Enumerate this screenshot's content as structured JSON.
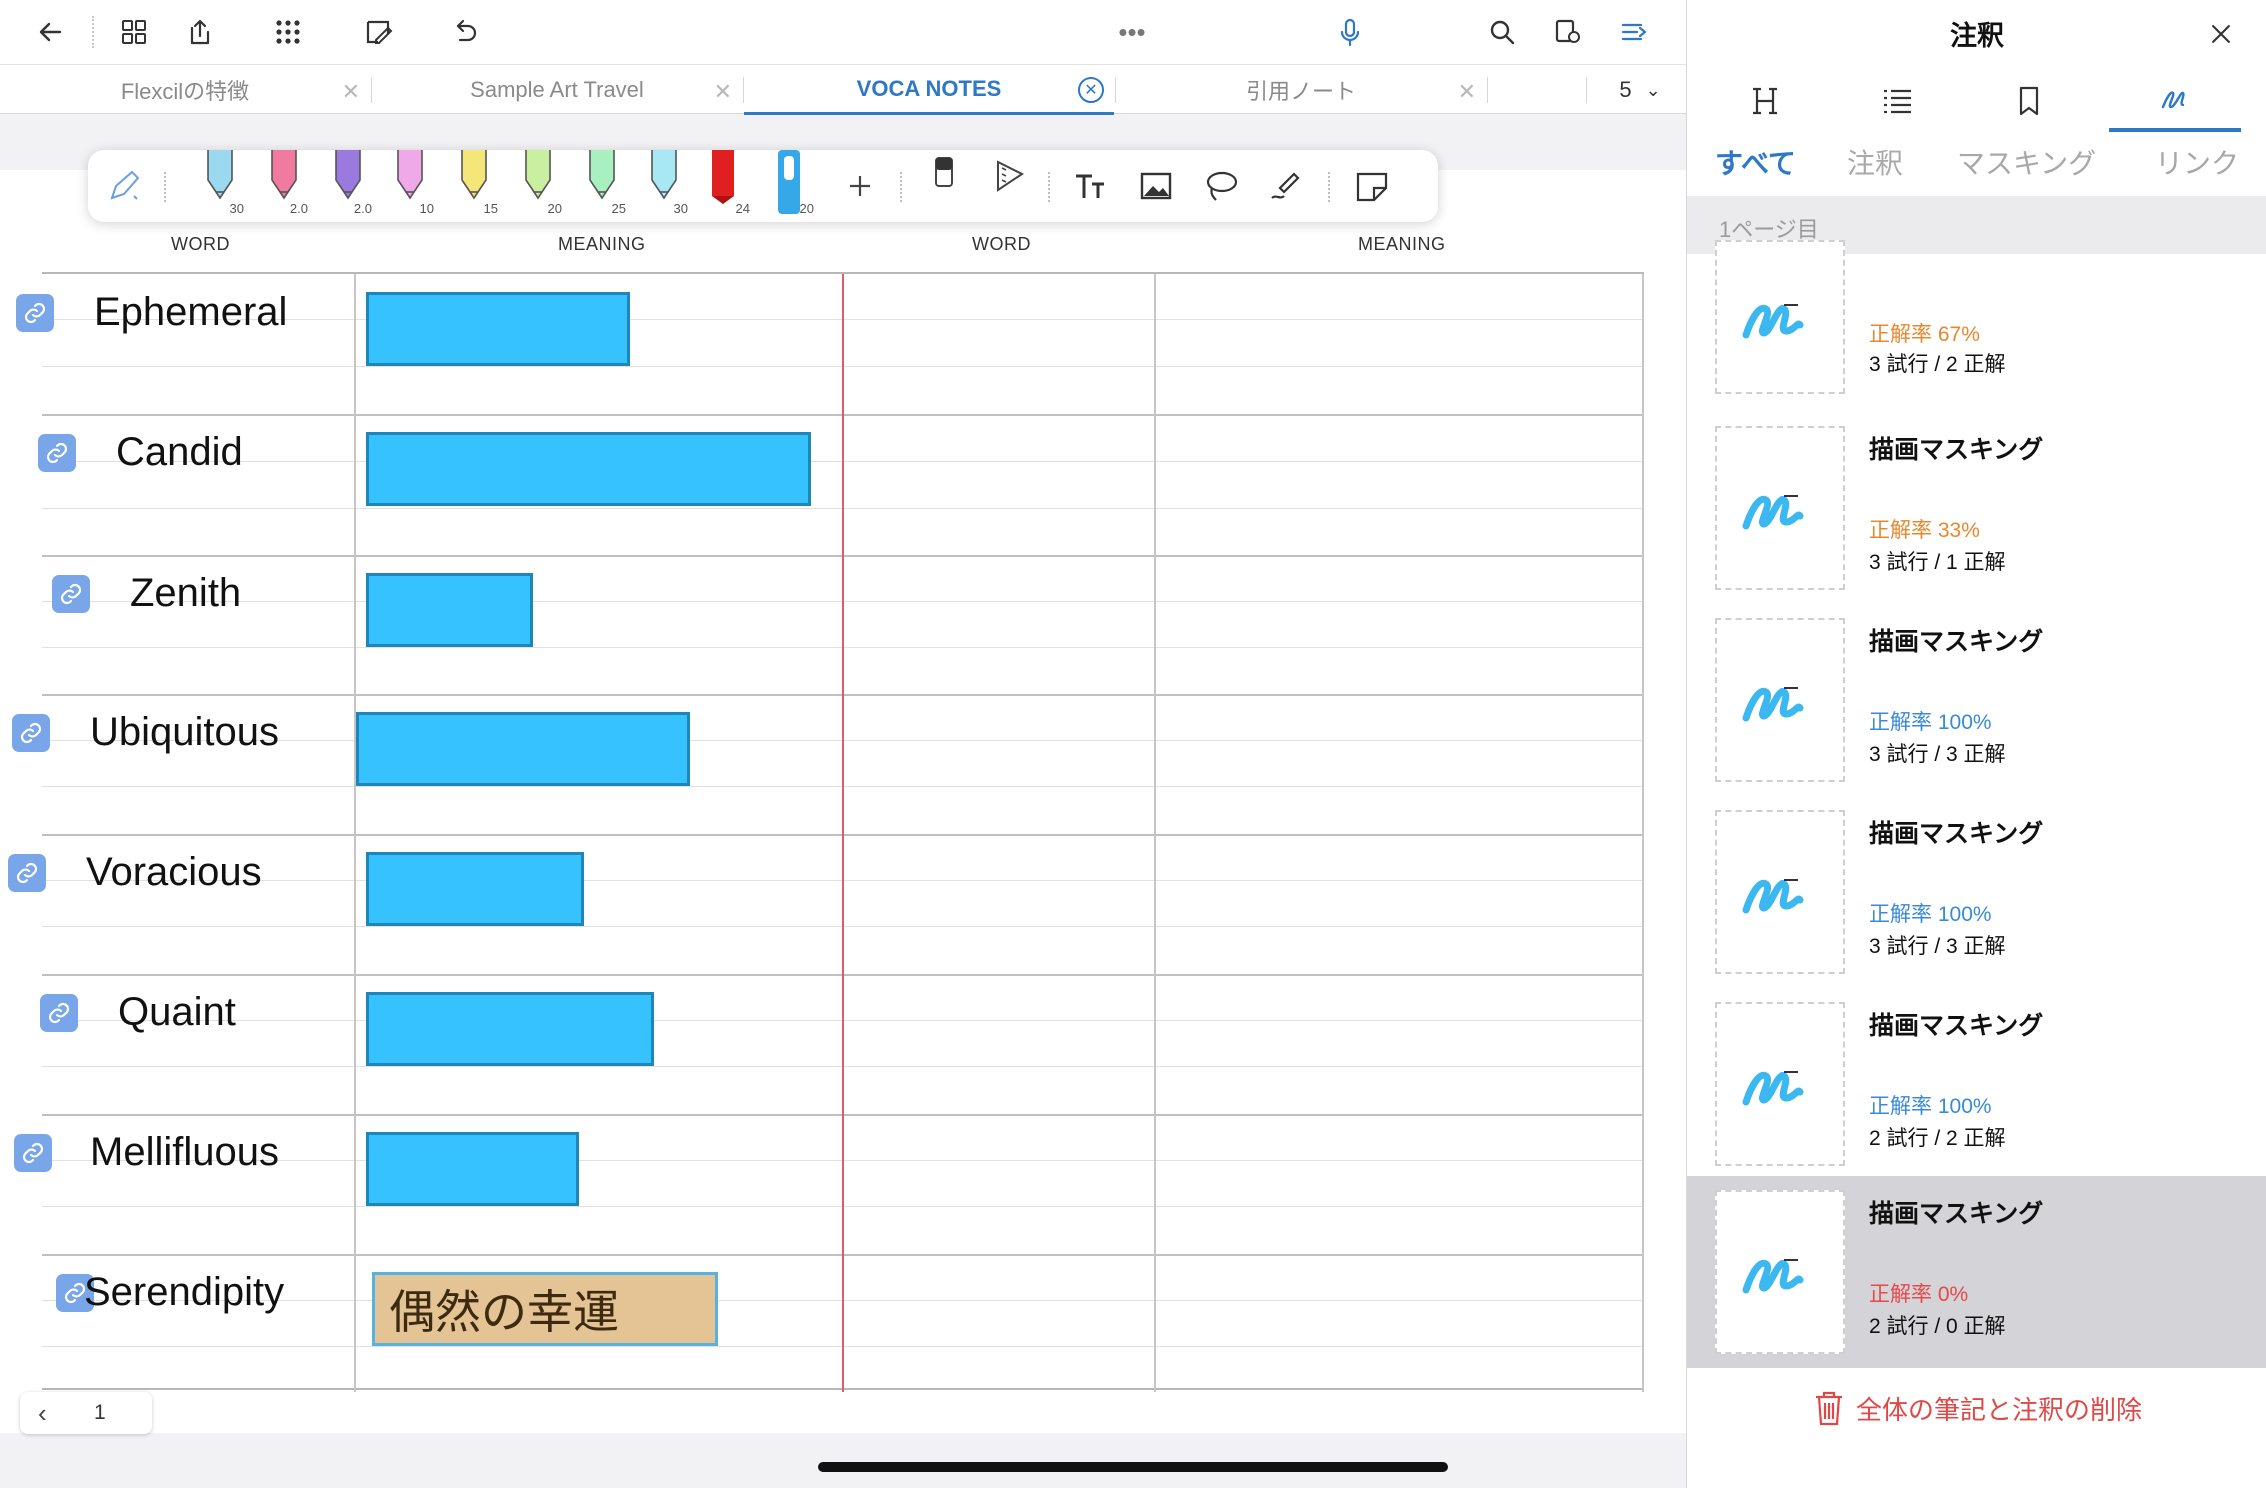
{
  "tabs": [
    {
      "label": "Flexcilの特徴"
    },
    {
      "label": "Sample Art Travel"
    },
    {
      "label": "VOCA NOTES"
    },
    {
      "label": "引用ノート"
    }
  ],
  "tab_count": "5",
  "more_dots": "•••",
  "pens": [
    {
      "size": "30",
      "color": "#9ad9f0"
    },
    {
      "size": "2.0",
      "color": "#f07aa0"
    },
    {
      "size": "2.0",
      "color": "#9b7ae0"
    },
    {
      "size": "10",
      "color": "#f0a8e8"
    },
    {
      "size": "15",
      "color": "#f5e67a"
    },
    {
      "size": "20",
      "color": "#c8f0a0"
    },
    {
      "size": "25",
      "color": "#a8f0c0"
    },
    {
      "size": "30",
      "color": "#a8e8f5"
    },
    {
      "size": "24",
      "color": "#e02020"
    },
    {
      "size": "20",
      "color": "#36a8e8"
    }
  ],
  "column_headers": [
    "WORD",
    "MEANING",
    "WORD",
    "MEANING"
  ],
  "words": [
    {
      "text": "Ephemeral",
      "mask_fraction": 0.57
    },
    {
      "text": "Candid",
      "mask_fraction": 0.96
    },
    {
      "text": "Zenith",
      "mask_fraction": 0.36
    },
    {
      "text": "Ubiquitous",
      "mask_fraction": 0.72
    },
    {
      "text": "Voracious",
      "mask_fraction": 0.47
    },
    {
      "text": "Quaint",
      "mask_fraction": 0.62
    },
    {
      "text": "Mellifluous",
      "mask_fraction": 0.46
    },
    {
      "text": "Serendipity",
      "answer": "偶然の幸運"
    }
  ],
  "page_nav": {
    "prev": "‹",
    "page": "1"
  },
  "panel": {
    "title": "注釈",
    "filter_tabs": [
      "すべて",
      "注釈",
      "マスキング",
      "リンク"
    ],
    "page_label": "1ページ目",
    "cards": [
      {
        "title": "",
        "rate": "正解率 67%",
        "rate_color": "#e8872e",
        "count": "3 試行 / 2 正解"
      },
      {
        "title": "描画マスキング",
        "rate": "正解率 33%",
        "rate_color": "#e8872e",
        "count": "3 試行 / 1 正解"
      },
      {
        "title": "描画マスキング",
        "rate": "正解率 100%",
        "rate_color": "#3a8ad8",
        "count": "3 試行 / 3 正解"
      },
      {
        "title": "描画マスキング",
        "rate": "正解率 100%",
        "rate_color": "#3a8ad8",
        "count": "3 試行 / 3 正解"
      },
      {
        "title": "描画マスキング",
        "rate": "正解率 100%",
        "rate_color": "#3a8ad8",
        "count": "2 試行 / 2 正解"
      },
      {
        "title": "描画マスキング",
        "rate": "正解率 0%",
        "rate_color": "#e84848",
        "count": "2 試行 / 0 正解"
      }
    ],
    "delete_label": "全体の筆記と注釈の削除"
  },
  "colors": {
    "accent": "#2e78c8",
    "mask": "#36c2ff",
    "danger": "#e04848"
  }
}
